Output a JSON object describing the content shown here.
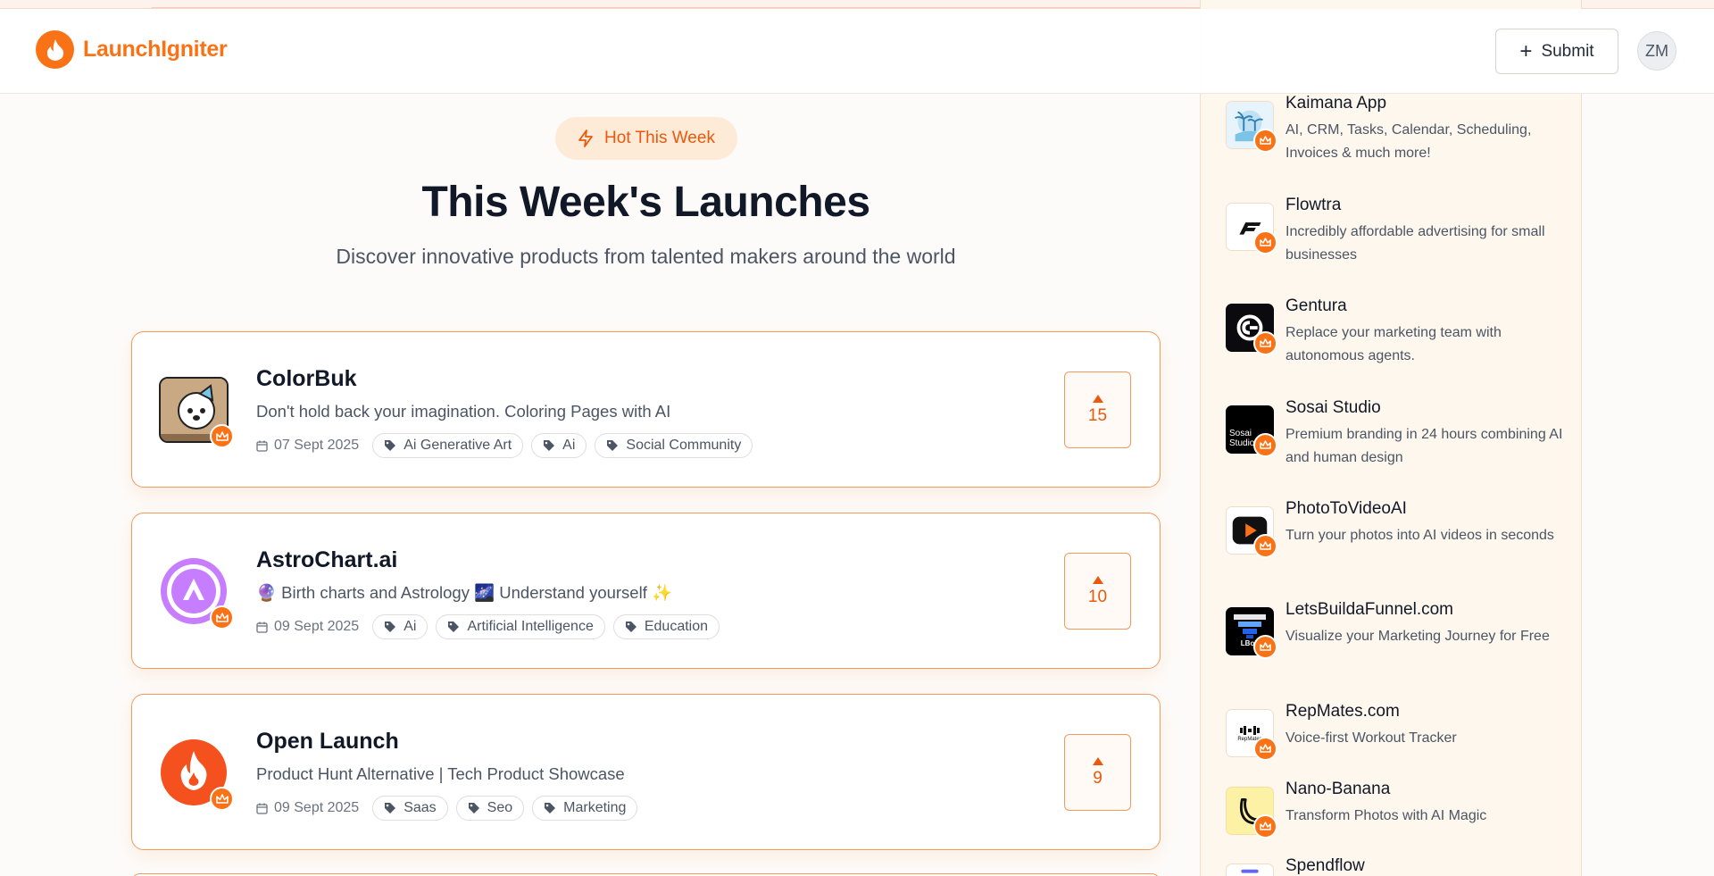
{
  "header": {
    "brand": "LaunchIgniter",
    "submit_label": "Submit",
    "avatar_initials": "ZM"
  },
  "main": {
    "pill_label": "Hot This Week",
    "title": "This Week's Launches",
    "subtitle": "Discover innovative products from talented makers around the world"
  },
  "launches": [
    {
      "name": "ColorBuk",
      "description": "Don't hold back your imagination. Coloring Pages with AI",
      "date": "07 Sept 2025",
      "tags": [
        "Ai Generative Art",
        "Ai",
        "Social Community"
      ],
      "votes": "15"
    },
    {
      "name": "AstroChart.ai",
      "description": "🔮 Birth charts and Astrology 🌌 Understand yourself ✨",
      "date": "09 Sept 2025",
      "tags": [
        "Ai",
        "Artificial Intelligence",
        "Education"
      ],
      "votes": "10"
    },
    {
      "name": "Open Launch",
      "description": "Product Hunt Alternative | Tech Product Showcase",
      "date": "09 Sept 2025",
      "tags": [
        "Saas",
        "Seo",
        "Marketing"
      ],
      "votes": "9"
    }
  ],
  "sidebar": {
    "items": [
      {
        "name": "Kaimana App",
        "description": "AI, CRM, Tasks, Calendar, Scheduling, Invoices & much more!"
      },
      {
        "name": "Flowtra",
        "description": "Incredibly affordable advertising for small businesses"
      },
      {
        "name": "Gentura",
        "description": "Replace your marketing team with autonomous agents."
      },
      {
        "name": "Sosai Studio",
        "description": "Premium branding in 24 hours combining AI and human design",
        "logo_text": "Sosai Studio"
      },
      {
        "name": "PhotoToVideoAI",
        "description": "Turn your photos into AI videos in seconds"
      },
      {
        "name": "LetsBuildaFunnel.com",
        "description": "Visualize your Marketing Journey for Free",
        "logo_text": "LBoF"
      },
      {
        "name": "RepMates.com",
        "description": "Voice-first Workout Tracker",
        "logo_text": "RepMates"
      },
      {
        "name": "Nano-Banana",
        "description": "Transform Photos with AI Magic"
      },
      {
        "name": "Spendflow",
        "description": ""
      }
    ]
  },
  "colors": {
    "accent": "#f97316",
    "accent_dark": "#ea580c",
    "card_border": "#f39a5d",
    "sidebar_bg": "#fef7ee"
  }
}
